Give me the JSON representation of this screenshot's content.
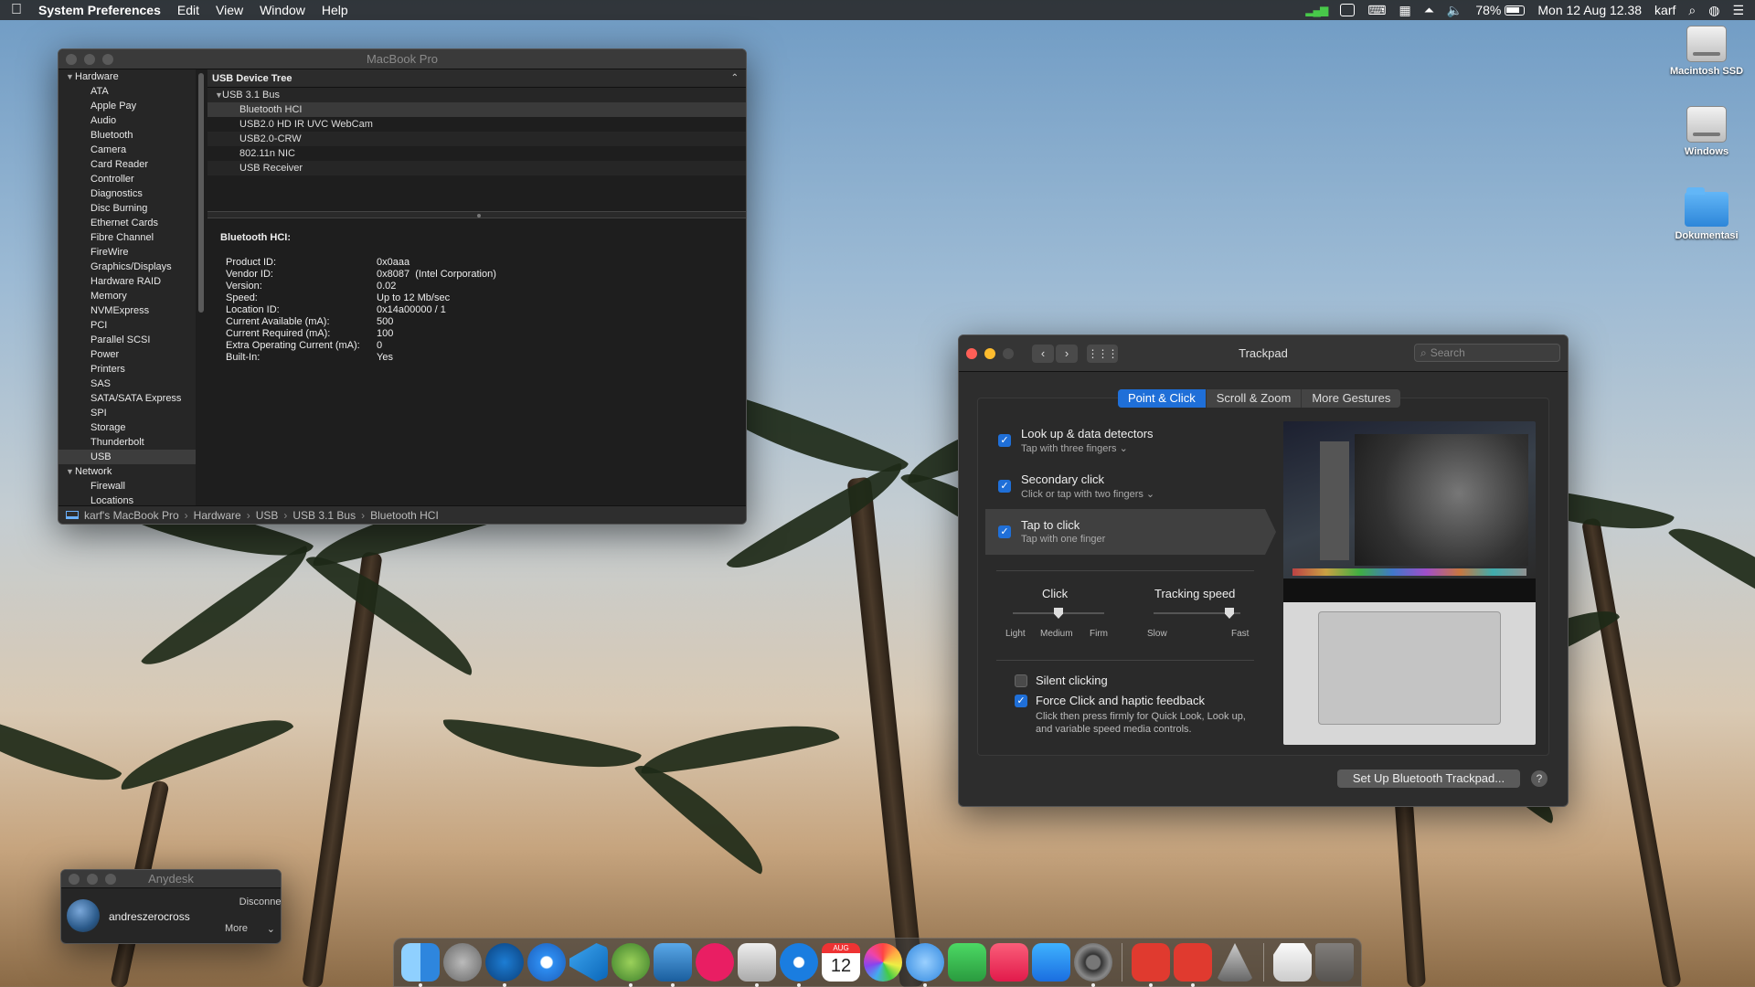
{
  "menubar": {
    "app": "System Preferences",
    "menus": [
      "Edit",
      "View",
      "Window",
      "Help"
    ],
    "battery": "78%",
    "datetime": "Mon 12 Aug 12.38",
    "user": "karf"
  },
  "sysinfo": {
    "title": "MacBook Pro",
    "sidebar": {
      "hardware_label": "Hardware",
      "hardware_items": [
        "ATA",
        "Apple Pay",
        "Audio",
        "Bluetooth",
        "Camera",
        "Card Reader",
        "Controller",
        "Diagnostics",
        "Disc Burning",
        "Ethernet Cards",
        "Fibre Channel",
        "FireWire",
        "Graphics/Displays",
        "Hardware RAID",
        "Memory",
        "NVMExpress",
        "PCI",
        "Parallel SCSI",
        "Power",
        "Printers",
        "SAS",
        "SATA/SATA Express",
        "SPI",
        "Storage",
        "Thunderbolt",
        "USB"
      ],
      "network_label": "Network",
      "network_items": [
        "Firewall",
        "Locations"
      ],
      "selected": "USB"
    },
    "tree": {
      "header": "USB Device Tree",
      "bus": "USB 3.1 Bus",
      "devices": [
        "Bluetooth HCI",
        "USB2.0 HD IR UVC WebCam",
        "USB2.0-CRW",
        "802.11n NIC",
        "USB Receiver"
      ]
    },
    "detail": {
      "heading": "Bluetooth HCI:",
      "keys": [
        "Product ID:",
        "Vendor ID:",
        "Version:",
        "Speed:",
        "Location ID:",
        "Current Available (mA):",
        "Current Required (mA):",
        "Extra Operating Current (mA):",
        "Built-In:"
      ],
      "values": [
        "0x0aaa",
        "0x8087  (Intel Corporation)",
        "0.02",
        "Up to 12 Mb/sec",
        "0x14a00000 / 1",
        "500",
        "100",
        "0",
        "Yes"
      ]
    },
    "breadcrumb": [
      "karf's MacBook Pro",
      "Hardware",
      "USB",
      "USB 3.1 Bus",
      "Bluetooth HCI"
    ]
  },
  "trackpad": {
    "title": "Trackpad",
    "search_placeholder": "Search",
    "tabs": [
      "Point & Click",
      "Scroll & Zoom",
      "More Gestures"
    ],
    "options": [
      {
        "title": "Look up & data detectors",
        "sub": "Tap with three fingers ⌄",
        "checked": true
      },
      {
        "title": "Secondary click",
        "sub": "Click or tap with two fingers ⌄",
        "checked": true
      },
      {
        "title": "Tap to click",
        "sub": "Tap with one finger",
        "checked": true
      }
    ],
    "click": {
      "label": "Click",
      "ticks": [
        "Light",
        "Medium",
        "Firm"
      ],
      "value": "Medium"
    },
    "tracking": {
      "label": "Tracking speed",
      "ticks": [
        "Slow",
        "Fast"
      ],
      "value_fraction": 0.9
    },
    "silent_clicking": {
      "label": "Silent clicking",
      "checked": false
    },
    "force_click": {
      "label": "Force Click and haptic feedback",
      "checked": true,
      "sub1": "Click then press firmly for Quick Look, Look up,",
      "sub2": "and variable speed media controls."
    },
    "setup_button": "Set Up Bluetooth Trackpad...",
    "help": "?"
  },
  "anydesk": {
    "title": "Anydesk",
    "user": "andreszerocross",
    "disconnect": "Disconnec",
    "more": "More"
  },
  "desktop_icons": [
    "Macintosh SSD",
    "Windows",
    "Dokumentasi"
  ],
  "dock_apps": [
    "finder",
    "launchpad",
    "dev-app",
    "safari",
    "vscode",
    "android-studio",
    "xcode-instruments",
    "flickr",
    "screenshot",
    "teamviewer",
    "calendar",
    "photos",
    "messages",
    "facetime",
    "music",
    "app-store",
    "system-preferences",
    "anydesk",
    "anydesk-2",
    "automator",
    "archive",
    "trash"
  ],
  "calendar_day": "12",
  "calendar_month": "AUG"
}
